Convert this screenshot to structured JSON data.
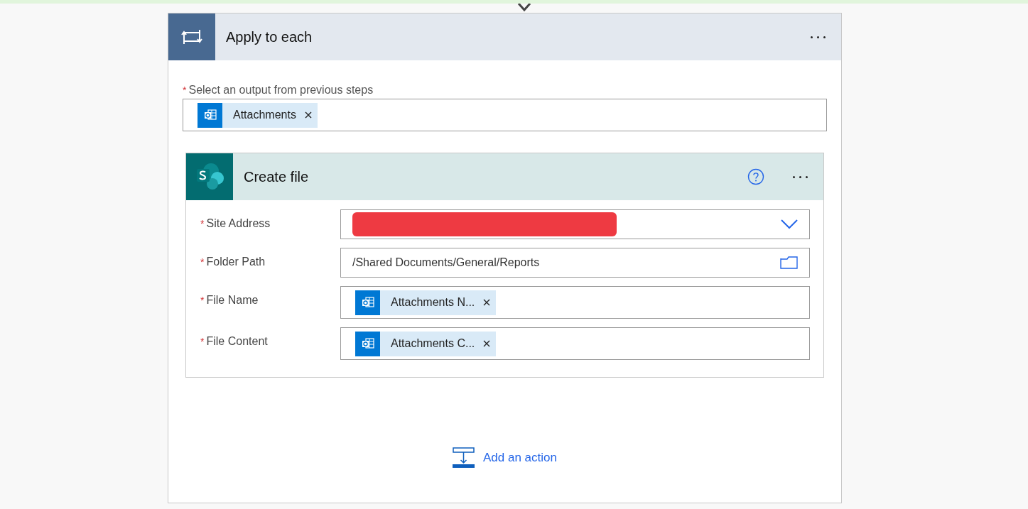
{
  "loop": {
    "title": "Apply to each",
    "input": {
      "label": "Select an output from previous steps",
      "required_mark": "*",
      "tokens": [
        {
          "label": "Attachments"
        }
      ]
    }
  },
  "action": {
    "title": "Create file",
    "fields": [
      {
        "kind": "dropdown",
        "label": "Site Address",
        "required_mark": "*",
        "redacted": true
      },
      {
        "kind": "folder",
        "label": "Folder Path",
        "required_mark": "*",
        "value": "/Shared Documents/General/Reports"
      },
      {
        "kind": "token",
        "label": "File Name",
        "required_mark": "*",
        "tokens": [
          {
            "label": "Attachments N..."
          }
        ]
      },
      {
        "kind": "token",
        "label": "File Content",
        "required_mark": "*",
        "tokens": [
          {
            "label": "Attachments C..."
          }
        ]
      }
    ]
  },
  "add_action": {
    "label": "Add an action"
  }
}
